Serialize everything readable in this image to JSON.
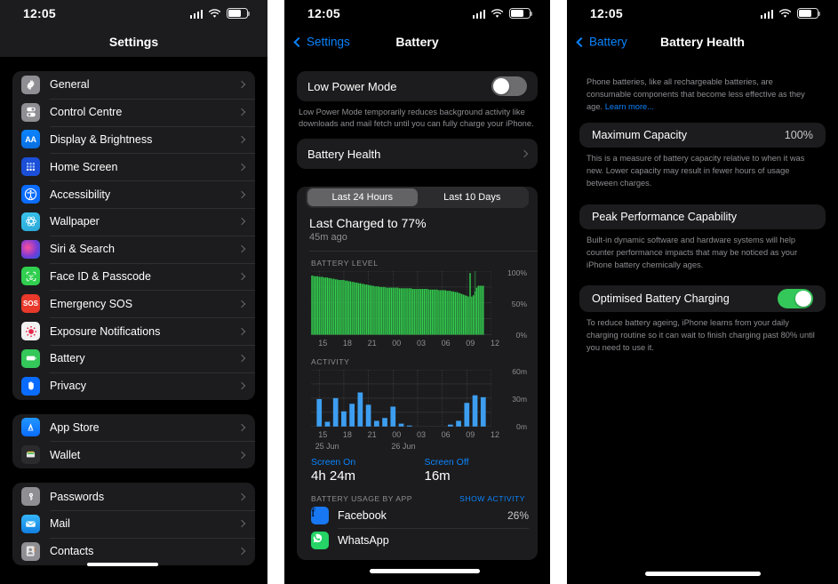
{
  "statusbar": {
    "time": "12:05",
    "icons": [
      "cellular-icon",
      "wifi-icon",
      "battery-icon"
    ]
  },
  "panel_settings": {
    "title": "Settings",
    "groups": [
      {
        "items": [
          {
            "label": "General",
            "icon": "gear-icon"
          },
          {
            "label": "Control Centre",
            "icon": "control-centre-icon"
          },
          {
            "label": "Display & Brightness",
            "icon": "display-brightness-icon"
          },
          {
            "label": "Home Screen",
            "icon": "home-screen-icon"
          },
          {
            "label": "Accessibility",
            "icon": "accessibility-icon"
          },
          {
            "label": "Wallpaper",
            "icon": "wallpaper-icon"
          },
          {
            "label": "Siri & Search",
            "icon": "siri-icon"
          },
          {
            "label": "Face ID & Passcode",
            "icon": "face-id-icon"
          },
          {
            "label": "Emergency SOS",
            "icon": "emergency-sos-icon"
          },
          {
            "label": "Exposure Notifications",
            "icon": "exposure-notifications-icon"
          },
          {
            "label": "Battery",
            "icon": "battery-icon"
          },
          {
            "label": "Privacy",
            "icon": "privacy-hand-icon"
          }
        ]
      },
      {
        "items": [
          {
            "label": "App Store",
            "icon": "app-store-icon"
          },
          {
            "label": "Wallet",
            "icon": "wallet-icon"
          }
        ]
      },
      {
        "items": [
          {
            "label": "Passwords",
            "icon": "passwords-key-icon"
          },
          {
            "label": "Mail",
            "icon": "mail-icon"
          },
          {
            "label": "Contacts",
            "icon": "contacts-icon"
          }
        ]
      }
    ]
  },
  "panel_battery": {
    "back_label": "Settings",
    "title": "Battery",
    "low_power_mode": {
      "label": "Low Power Mode",
      "enabled": false,
      "footnote": "Low Power Mode temporarily reduces background activity like downloads and mail fetch until you can fully charge your iPhone."
    },
    "battery_health_row": {
      "label": "Battery Health"
    },
    "segments": [
      {
        "label": "Last 24 Hours",
        "active": true
      },
      {
        "label": "Last 10 Days",
        "active": false
      }
    ],
    "last_charged_title": "Last Charged to 77%",
    "last_charged_sub": "45m ago",
    "screen_on": {
      "label": "Screen On",
      "value": "4h 24m"
    },
    "screen_off": {
      "label": "Screen Off",
      "value": "16m"
    },
    "usage_header": {
      "left": "BATTERY USAGE BY APP",
      "right": "SHOW ACTIVITY"
    },
    "apps": [
      {
        "name": "Facebook",
        "pct": "26%",
        "icon": "facebook-icon"
      },
      {
        "name": "WhatsApp",
        "pct": "",
        "icon": "whatsapp-icon"
      }
    ],
    "colors": {
      "battery_green": "#33d14f",
      "activity_blue": "#3d9ef0",
      "accent": "#0a84ff"
    }
  },
  "panel_health": {
    "back_label": "Battery",
    "title": "Battery Health",
    "intro": "Phone batteries, like all rechargeable batteries, are consumable components that become less effective as they age. ",
    "intro_link": "Learn more...",
    "maximum_capacity": {
      "label": "Maximum Capacity",
      "value": "100%"
    },
    "maximum_capacity_note": "This is a measure of battery capacity relative to when it was new. Lower capacity may result in fewer hours of usage between charges.",
    "peak_performance": {
      "label": "Peak Performance Capability"
    },
    "peak_performance_note": "Built-in dynamic software and hardware systems will help counter performance impacts that may be noticed as your iPhone battery chemically ages.",
    "optimised_charging": {
      "label": "Optimised Battery Charging",
      "enabled": true
    },
    "optimised_charging_note": "To reduce battery ageing, iPhone learns from your daily charging routine so it can wait to finish charging past 80% until you need to use it."
  },
  "chart_data": [
    {
      "type": "bar",
      "title": "BATTERY LEVEL",
      "xlabel": "",
      "ylabel": "",
      "ylim": [
        0,
        100
      ],
      "ytick_labels": [
        "100%",
        "50%",
        "0%"
      ],
      "yticks": [
        100,
        50,
        0
      ],
      "xtick_labels": [
        "15",
        "18",
        "21",
        "00",
        "03",
        "06",
        "09",
        "12"
      ],
      "xticks": [
        15,
        18,
        21,
        24,
        27,
        30,
        33,
        36
      ],
      "grid": true,
      "bar_color": "#33d14f",
      "x": [
        14.0,
        14.2,
        14.4,
        14.6,
        14.8,
        15.0,
        15.2,
        15.4,
        15.6,
        15.8,
        16.0,
        16.2,
        16.4,
        16.6,
        16.8,
        17.0,
        17.2,
        17.4,
        17.6,
        17.8,
        18.0,
        18.2,
        18.4,
        18.6,
        18.8,
        19.0,
        19.2,
        19.4,
        19.6,
        19.8,
        20.0,
        20.2,
        20.4,
        20.6,
        20.8,
        21.0,
        21.2,
        21.4,
        21.6,
        21.8,
        22.0,
        22.2,
        22.4,
        22.6,
        22.8,
        23.0,
        23.2,
        23.4,
        23.6,
        23.8,
        24.0,
        24.2,
        24.4,
        24.6,
        24.8,
        25.0,
        25.2,
        25.4,
        25.6,
        25.8,
        26.0,
        26.2,
        26.4,
        26.6,
        26.8,
        27.0,
        27.2,
        27.4,
        27.6,
        27.8,
        28.0,
        28.2,
        28.4,
        28.6,
        28.8,
        29.0,
        29.2,
        29.4,
        29.6,
        29.8,
        30.0,
        30.2,
        30.4,
        30.6,
        30.8,
        31.0,
        31.2,
        31.4,
        31.6,
        31.8,
        32.0,
        32.2,
        32.4,
        32.6,
        32.8,
        33.0,
        33.2,
        33.4,
        33.6,
        33.8,
        34.0,
        34.2,
        34.4,
        34.6,
        34.8,
        35.0
      ],
      "values": [
        93,
        93,
        92,
        92,
        92,
        91,
        91,
        91,
        90,
        90,
        90,
        89,
        89,
        88,
        88,
        87,
        87,
        86,
        86,
        86,
        86,
        85,
        85,
        84,
        84,
        83,
        83,
        82,
        82,
        81,
        81,
        80,
        80,
        79,
        79,
        78,
        78,
        77,
        77,
        76,
        76,
        76,
        75,
        75,
        75,
        75,
        74,
        74,
        74,
        74,
        74,
        74,
        74,
        74,
        73,
        73,
        73,
        73,
        73,
        73,
        73,
        73,
        72,
        72,
        72,
        72,
        72,
        72,
        72,
        72,
        72,
        72,
        71,
        71,
        71,
        71,
        71,
        71,
        70,
        70,
        70,
        70,
        70,
        69,
        69,
        69,
        68,
        68,
        67,
        67,
        66,
        65,
        64,
        63,
        62,
        61,
        60,
        97,
        60,
        62,
        68,
        74,
        77,
        77,
        77,
        77
      ],
      "annotation": "Charging spike near 10:00-11:00 reaching 100%"
    },
    {
      "type": "bar",
      "title": "ACTIVITY",
      "xlabel": "",
      "ylabel": "",
      "ylim": [
        0,
        60
      ],
      "ytick_labels": [
        "60m",
        "30m",
        "0m"
      ],
      "yticks": [
        60,
        30,
        0
      ],
      "xtick_labels": [
        "15",
        "18",
        "21",
        "00",
        "03",
        "06",
        "09",
        "12"
      ],
      "xticks": [
        15,
        18,
        21,
        24,
        27,
        30,
        33,
        36
      ],
      "date_labels": [
        {
          "text": "25 Jun",
          "at": 14.5
        },
        {
          "text": "26 Jun",
          "at": 23.8
        }
      ],
      "grid": true,
      "bar_color": "#3d9ef0",
      "categories": [
        "15",
        "16",
        "17",
        "18",
        "19",
        "20",
        "21",
        "22",
        "23",
        "00",
        "01",
        "02",
        "03",
        "04",
        "05",
        "06",
        "07",
        "08",
        "09",
        "10",
        "11"
      ],
      "values": [
        29,
        5,
        30,
        16,
        24,
        36,
        23,
        6,
        9,
        21,
        3,
        1,
        0,
        0,
        0,
        0,
        2,
        6,
        25,
        33,
        31
      ]
    }
  ]
}
